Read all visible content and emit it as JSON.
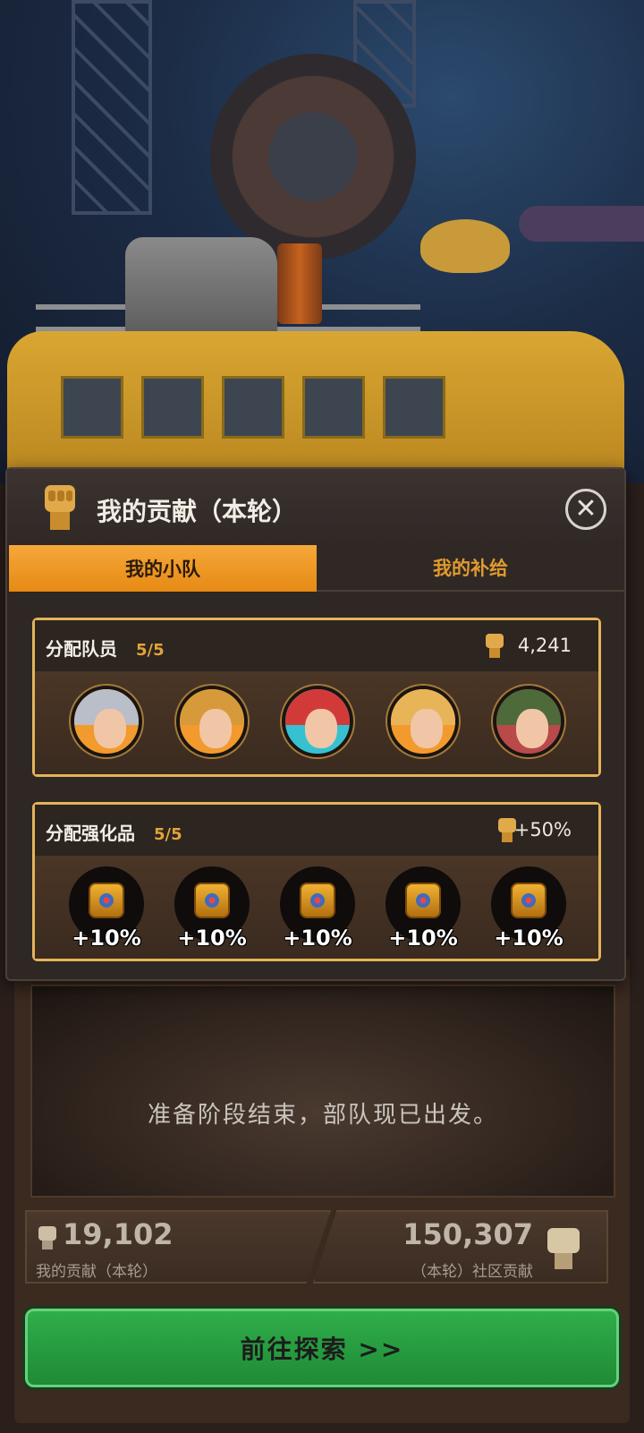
{
  "dialog": {
    "title": "我的贡献（本轮）",
    "close_symbol": "✕"
  },
  "tabs": [
    {
      "label": "我的小队",
      "active": true
    },
    {
      "label": "我的补给",
      "active": false
    }
  ],
  "members_section": {
    "title": "分配队员",
    "count": "5/5",
    "value": "4,241",
    "icon": "fist-icon",
    "avatars": [
      {
        "name": "white-hair-hero",
        "hair_color": "#b9bec8",
        "bg": "#f29a2e"
      },
      {
        "name": "blonde-woman-1",
        "hair_color": "#d69a3a",
        "bg": "#f29a2e"
      },
      {
        "name": "red-helmet-woman",
        "hair_color": "#d23a3a",
        "bg": "#37c1d0"
      },
      {
        "name": "blonde-woman-2",
        "hair_color": "#e8b458",
        "bg": "#f29a2e"
      },
      {
        "name": "pilot-soldier",
        "hair_color": "#4e6a3a",
        "bg": "#b84a4a"
      }
    ]
  },
  "boosts_section": {
    "title": "分配强化品",
    "count": "5/5",
    "value": "+50%",
    "icon": "fist-icon",
    "items": [
      {
        "label": "+10%",
        "icon": "compass-icon"
      },
      {
        "label": "+10%",
        "icon": "compass-icon"
      },
      {
        "label": "+10%",
        "icon": "compass-icon"
      },
      {
        "label": "+10%",
        "icon": "compass-icon"
      },
      {
        "label": "+10%",
        "icon": "compass-icon"
      }
    ]
  },
  "background": {
    "status_text": "准备阶段结束，部队现已出发。",
    "my_contribution": {
      "value": "19,102",
      "label": "我的贡献（本轮）"
    },
    "community_contribution": {
      "value": "150,307",
      "label": "（本轮）社区贡献"
    },
    "explore_button": "前往探索 >>"
  },
  "colors": {
    "accent": "#f6a73a",
    "section_border": "#e3b35a",
    "button_green": "#2fae4a"
  }
}
